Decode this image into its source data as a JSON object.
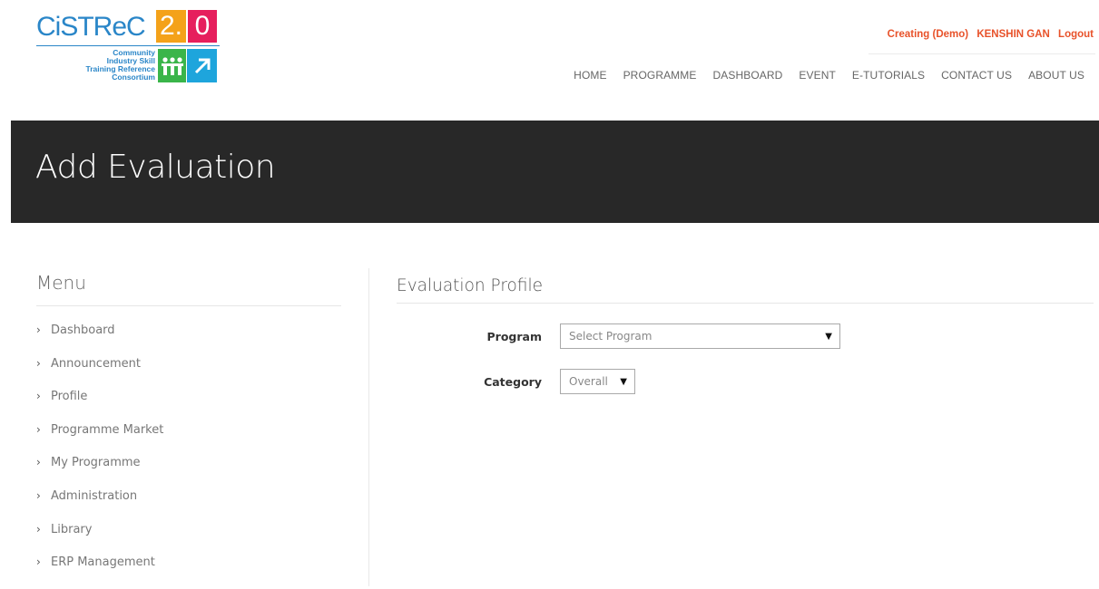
{
  "logo": {
    "word": "CiSTReC",
    "version_major": "2.",
    "version_minor": "0",
    "subtitle_lines": [
      "Community",
      "Industry Skill",
      "Training Reference",
      "Consortium"
    ],
    "colors": {
      "blue": "#2a86c8",
      "orange": "#f4a21a",
      "red": "#e61f5d",
      "green": "#3ab54a",
      "cyan": "#1ea5dc"
    }
  },
  "user_bar": {
    "mode": "Creating (Demo)",
    "user_name": "KENSHIN GAN",
    "logout": "Logout",
    "accent_color": "#e8522a"
  },
  "nav": {
    "items": [
      "HOME",
      "PROGRAMME",
      "DASHBOARD",
      "EVENT",
      "E-TUTORIALS",
      "CONTACT US",
      "ABOUT US"
    ]
  },
  "page": {
    "title": "Add Evaluation"
  },
  "sidebar": {
    "title": "Menu",
    "items": [
      {
        "label": "Dashboard"
      },
      {
        "label": "Announcement"
      },
      {
        "label": "Profile"
      },
      {
        "label": "Programme Market"
      },
      {
        "label": "My Programme"
      },
      {
        "label": "Administration"
      },
      {
        "label": "Library"
      },
      {
        "label": "ERP Management"
      }
    ]
  },
  "form": {
    "section_title": "Evaluation Profile",
    "program": {
      "label": "Program",
      "value": "Select Program"
    },
    "category": {
      "label": "Category",
      "value": "Overall"
    }
  }
}
